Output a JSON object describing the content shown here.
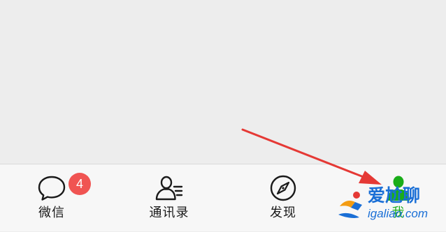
{
  "tab_bar": {
    "items": [
      {
        "label": "微信",
        "icon": "chat-bubble-icon",
        "badge": "4"
      },
      {
        "label": "通讯录",
        "icon": "contacts-icon"
      },
      {
        "label": "发现",
        "icon": "compass-icon"
      },
      {
        "label": "我",
        "icon": "person-icon"
      }
    ],
    "active_color": "#1aad19",
    "badge_color": "#f05452"
  },
  "annotation": {
    "arrow_color": "#e53935",
    "target": "我"
  },
  "watermark": {
    "title": "爱尬聊",
    "domain": "igaliao.com"
  }
}
